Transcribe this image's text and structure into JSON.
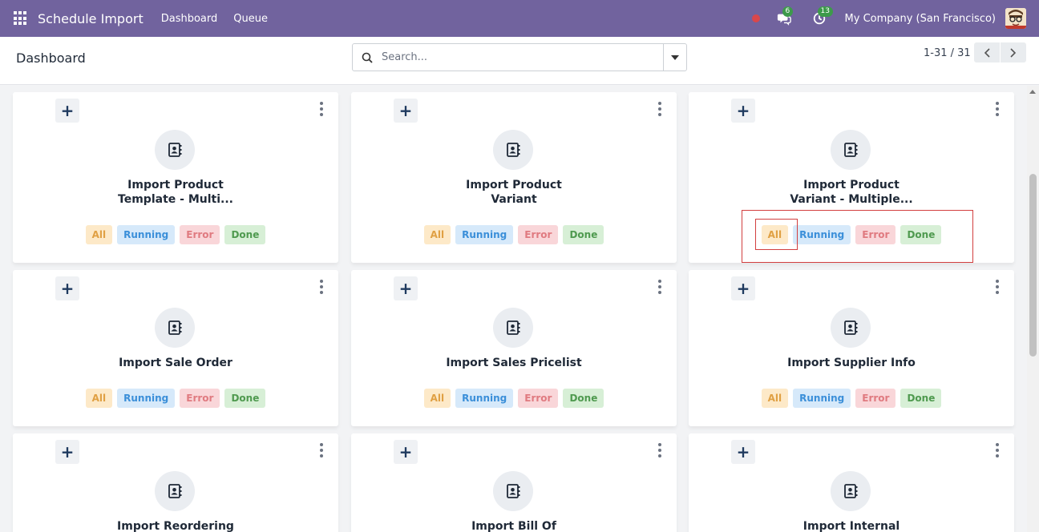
{
  "navbar": {
    "app_title": "Schedule Import",
    "menu": [
      "Dashboard",
      "Queue"
    ],
    "messages_badge": "6",
    "activities_badge": "13",
    "company": "My Company (San Francisco)"
  },
  "control_panel": {
    "breadcrumb": "Dashboard",
    "search_placeholder": "Search...",
    "pager": "1-31 / 31"
  },
  "badge_labels": {
    "all": "All",
    "running": "Running",
    "error": "Error",
    "done": "Done"
  },
  "cards": [
    {
      "title_line1": "Import Product",
      "title_line2": "Template - Multi...",
      "badges": true
    },
    {
      "title_line1": "Import Product",
      "title_line2": "Variant",
      "badges": true
    },
    {
      "title_line1": "Import Product",
      "title_line2": "Variant - Multiple...",
      "badges": true
    },
    {
      "title_line1": "Import Sale Order",
      "title_line2": "",
      "badges": true
    },
    {
      "title_line1": "Import Sales Pricelist",
      "title_line2": "",
      "badges": true
    },
    {
      "title_line1": "Import Supplier Info",
      "title_line2": "",
      "badges": true
    },
    {
      "title_line1": "Import Reordering",
      "title_line2": "",
      "badges": false
    },
    {
      "title_line1": "Import Bill Of",
      "title_line2": "",
      "badges": false
    },
    {
      "title_line1": "Import Internal",
      "title_line2": "",
      "badges": false
    }
  ],
  "colors": {
    "navbar": "#71639e",
    "all": "#e0a043",
    "running": "#3b8fd9",
    "error": "#e07a80",
    "done": "#4f9a4f",
    "highlight": "#d23f3f"
  },
  "icons": {
    "apps": "apps-grid-icon",
    "record": "record-dot-icon",
    "messages": "chat-icon",
    "activities": "clock-icon",
    "search": "search-icon",
    "dropdown": "caret-down-icon",
    "add": "plus-icon",
    "menu": "kebab-icon",
    "card": "contact-book-icon"
  }
}
